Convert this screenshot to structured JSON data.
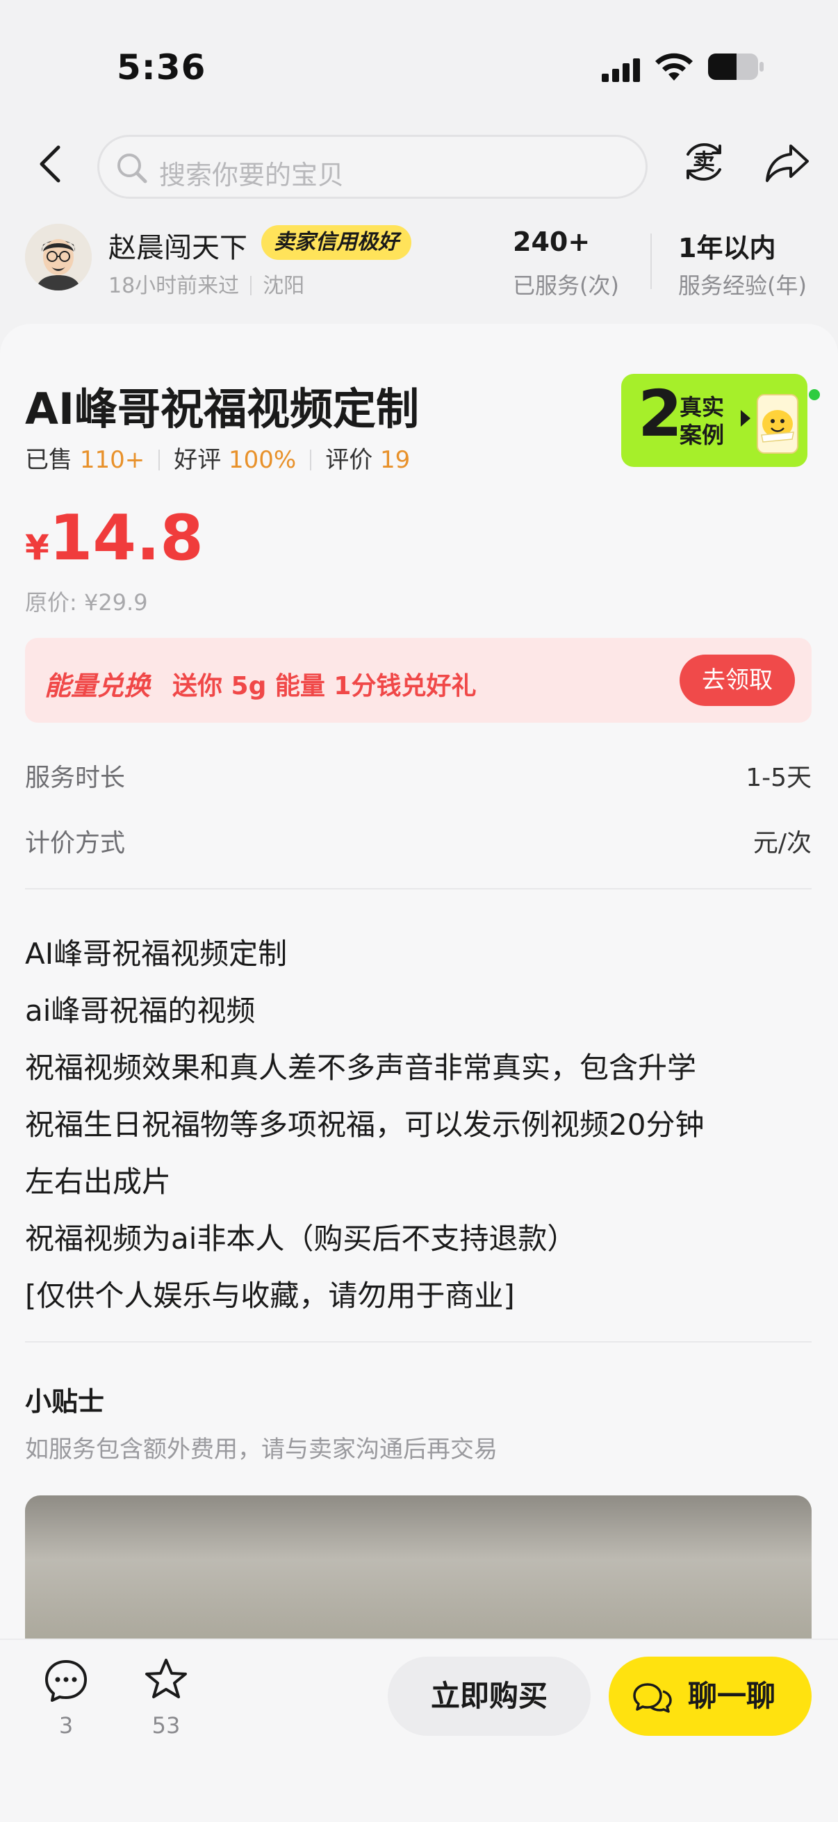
{
  "status_bar": {
    "time": "5:36"
  },
  "nav": {
    "search_placeholder": "搜索你要的宝贝",
    "sell_icon_char": "卖"
  },
  "seller": {
    "name": "赵晨闯天下",
    "badge": "卖家信用极好",
    "last_seen": "18小时前来过",
    "location": "沈阳",
    "stats": [
      {
        "value": "240+",
        "label": "已服务(次)"
      },
      {
        "value": "1年以内",
        "label": "服务经验(年)"
      }
    ]
  },
  "product": {
    "title": "AI峰哥祝福视频定制",
    "sold_label": "已售",
    "sold_value": "110+",
    "good_label": "好评",
    "good_value": "100%",
    "review_label": "评价",
    "review_value": "19",
    "cases_count": "2",
    "cases_line1": "真实",
    "cases_line2": "案例",
    "currency": "¥",
    "price": "14.8",
    "original_price": "原价: ¥29.9"
  },
  "energy": {
    "title": "能量兑换",
    "desc": "送你 5g 能量 1分钱兑好礼",
    "button": "去领取"
  },
  "details": [
    {
      "label": "服务时长",
      "value": "1-5天"
    },
    {
      "label": "计价方式",
      "value": "元/次"
    }
  ],
  "description": [
    "AI峰哥祝福视频定制",
    "ai峰哥祝福的视频",
    "祝福视频效果和真人差不多声音非常真实，包含升学",
    "祝福生日祝福物等多项祝福，可以发示例视频20分钟",
    "左右出成片",
    "祝福视频为ai非本人（购买后不支持退款）",
    "[仅供个人娱乐与收藏，请勿用于商业]"
  ],
  "tips": {
    "title": "小贴士",
    "text": "如服务包含额外费用，请与卖家沟通后再交易"
  },
  "bottom_bar": {
    "comment_count": "3",
    "favorite_count": "53",
    "buy_label": "立即购买",
    "chat_label": "聊一聊"
  },
  "colors": {
    "price_red": "#f03c3c",
    "badge_yellow": "#ffe35a",
    "chat_yellow": "#ffe20f",
    "cases_green": "#a6ef2a",
    "stat_orange": "#e8912a"
  }
}
